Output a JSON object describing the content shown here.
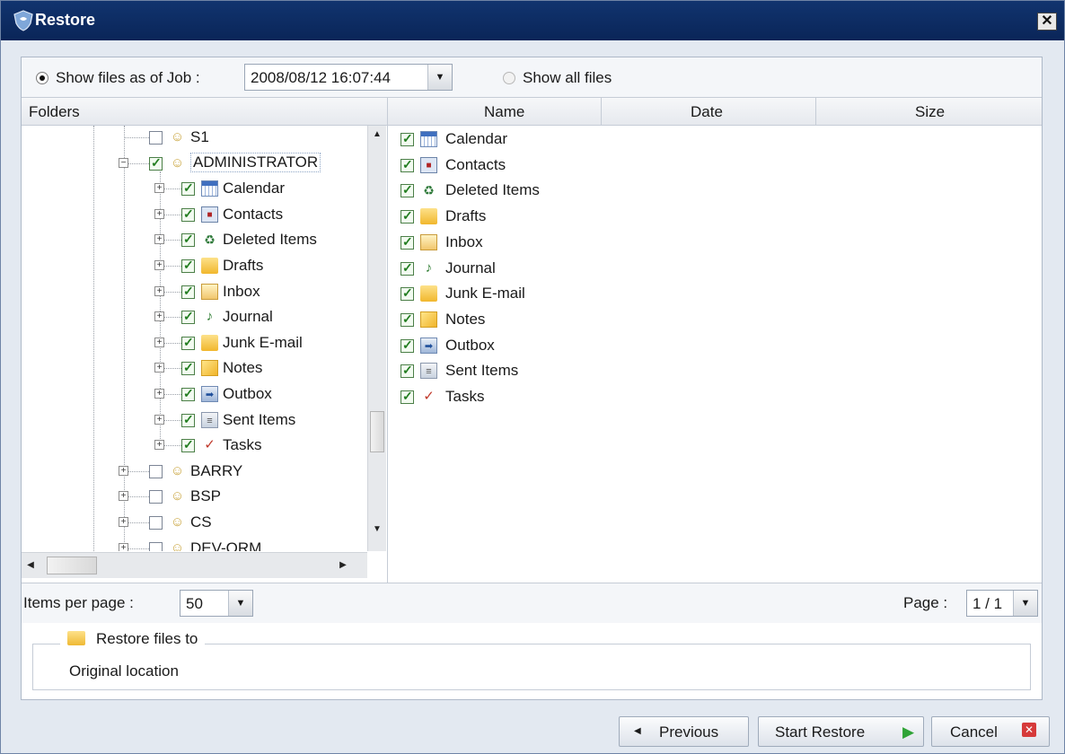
{
  "window": {
    "title": "Restore",
    "close_glyph": "✕"
  },
  "options": {
    "job_radio_label": "Show files as of Job :",
    "job_radio_selected": true,
    "job_date_value": "2008/08/12 16:07:44",
    "all_files_label": "Show all files",
    "all_files_selected": false
  },
  "folders_header": "Folders",
  "columns": {
    "name": "Name",
    "date": "Date",
    "size": "Size"
  },
  "tree": [
    {
      "label": "S1",
      "checked": false,
      "icon": "user-folder-icon",
      "level": 1,
      "expander": ""
    },
    {
      "label": "ADMINISTRATOR",
      "checked": true,
      "icon": "user-folder-icon",
      "level": 1,
      "expander": "-",
      "selected": true
    },
    {
      "label": "Calendar",
      "checked": true,
      "icon": "calendar-icon",
      "level": 2,
      "expander": "+"
    },
    {
      "label": "Contacts",
      "checked": true,
      "icon": "contacts-icon",
      "level": 2,
      "expander": "+"
    },
    {
      "label": "Deleted Items",
      "checked": true,
      "icon": "deleted-items-icon",
      "level": 2,
      "expander": "+"
    },
    {
      "label": "Drafts",
      "checked": true,
      "icon": "folder-icon",
      "level": 2,
      "expander": "+"
    },
    {
      "label": "Inbox",
      "checked": true,
      "icon": "inbox-icon",
      "level": 2,
      "expander": "+"
    },
    {
      "label": "Journal",
      "checked": true,
      "icon": "journal-icon",
      "level": 2,
      "expander": "+"
    },
    {
      "label": "Junk E-mail",
      "checked": true,
      "icon": "folder-icon",
      "level": 2,
      "expander": "+"
    },
    {
      "label": "Notes",
      "checked": true,
      "icon": "notes-icon",
      "level": 2,
      "expander": "+"
    },
    {
      "label": "Outbox",
      "checked": true,
      "icon": "outbox-icon",
      "level": 2,
      "expander": "+"
    },
    {
      "label": "Sent Items",
      "checked": true,
      "icon": "sent-items-icon",
      "level": 2,
      "expander": "+"
    },
    {
      "label": "Tasks",
      "checked": true,
      "icon": "tasks-icon",
      "level": 2,
      "expander": "+"
    },
    {
      "label": "BARRY",
      "checked": false,
      "icon": "user-folder-icon",
      "level": 1,
      "expander": "+"
    },
    {
      "label": "BSP",
      "checked": false,
      "icon": "user-folder-icon",
      "level": 1,
      "expander": "+"
    },
    {
      "label": "CS",
      "checked": false,
      "icon": "user-folder-icon",
      "level": 1,
      "expander": "+"
    },
    {
      "label": "DEV-ORM",
      "checked": false,
      "icon": "user-folder-icon",
      "level": 1,
      "expander": "+"
    }
  ],
  "files": [
    {
      "name": "Calendar",
      "checked": true,
      "icon": "calendar-icon"
    },
    {
      "name": "Contacts",
      "checked": true,
      "icon": "contacts-icon"
    },
    {
      "name": "Deleted Items",
      "checked": true,
      "icon": "deleted-items-icon"
    },
    {
      "name": "Drafts",
      "checked": true,
      "icon": "folder-icon"
    },
    {
      "name": "Inbox",
      "checked": true,
      "icon": "inbox-icon"
    },
    {
      "name": "Journal",
      "checked": true,
      "icon": "journal-icon"
    },
    {
      "name": "Junk E-mail",
      "checked": true,
      "icon": "folder-icon"
    },
    {
      "name": "Notes",
      "checked": true,
      "icon": "notes-icon"
    },
    {
      "name": "Outbox",
      "checked": true,
      "icon": "outbox-icon"
    },
    {
      "name": "Sent Items",
      "checked": true,
      "icon": "sent-items-icon"
    },
    {
      "name": "Tasks",
      "checked": true,
      "icon": "tasks-icon"
    }
  ],
  "paging": {
    "items_per_page_label": "Items per page :",
    "items_per_page_value": "50",
    "page_label": "Page :",
    "page_value": "1 / 1"
  },
  "restore_to": {
    "heading": "Restore files to",
    "value": "Original location"
  },
  "buttons": {
    "previous": "Previous",
    "start_restore": "Start Restore",
    "cancel": "Cancel"
  }
}
